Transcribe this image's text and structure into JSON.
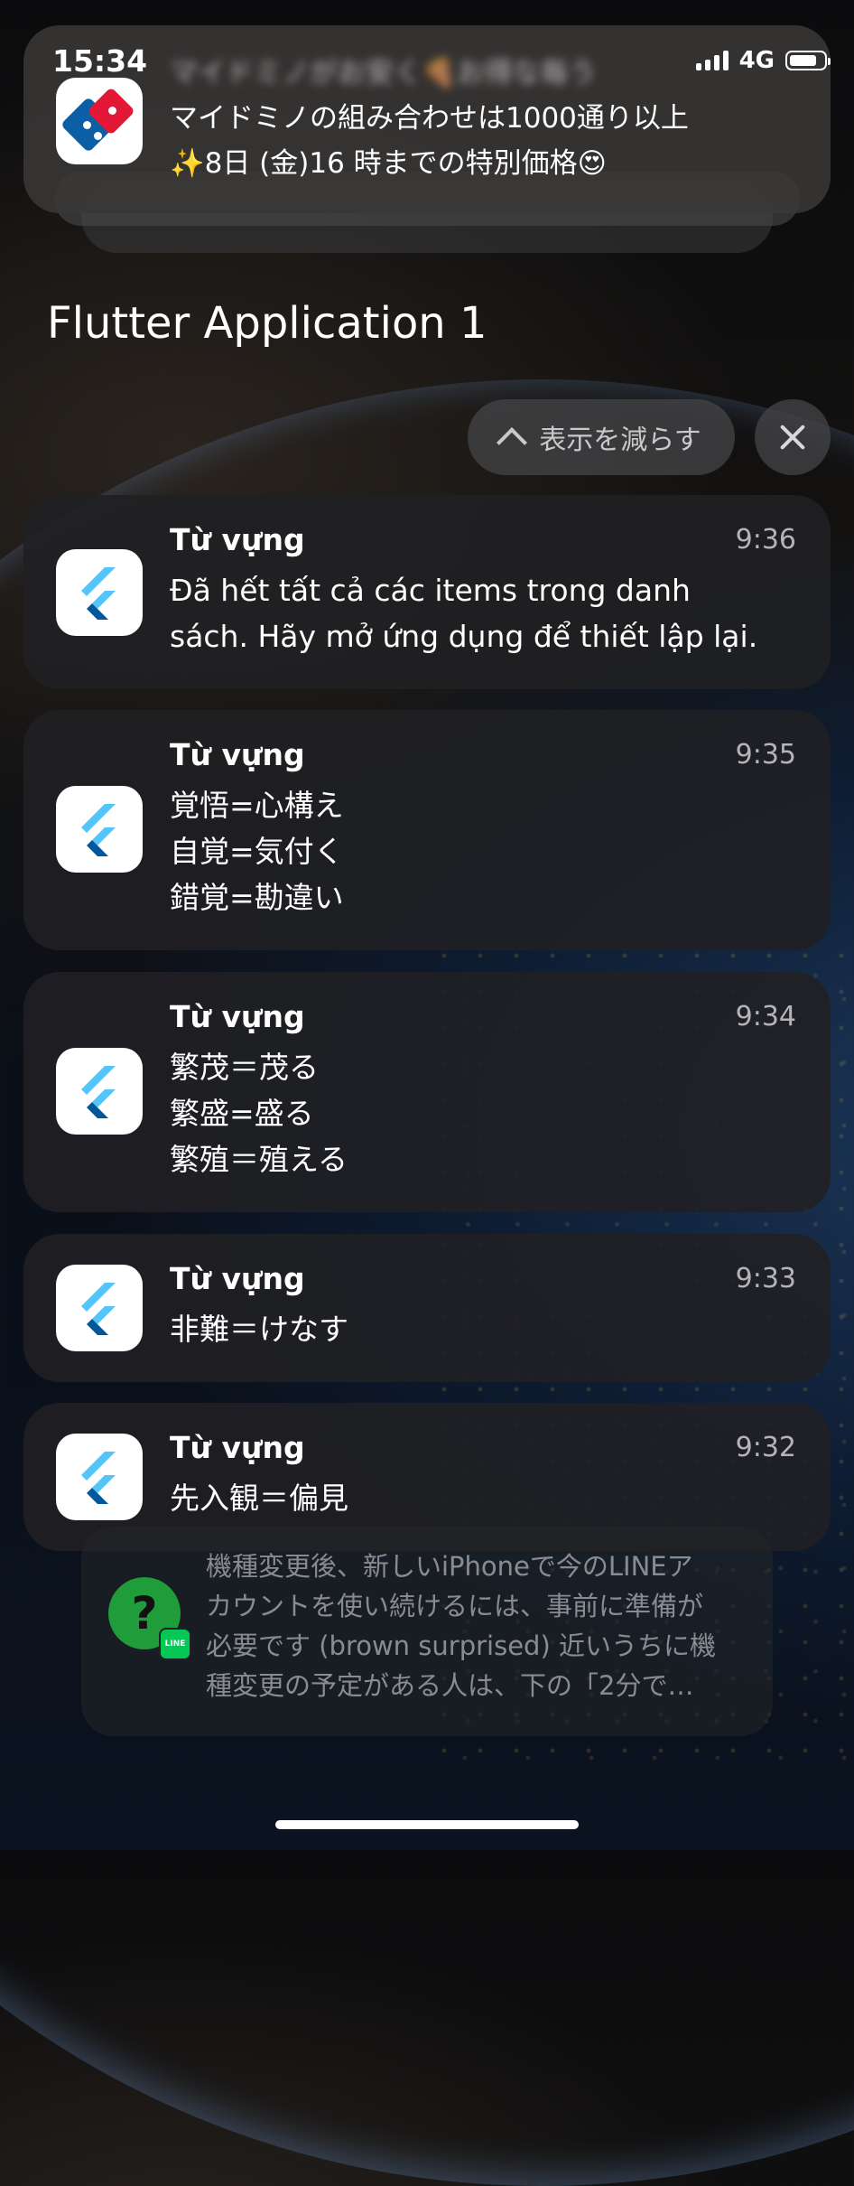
{
  "status_bar": {
    "time": "15:34",
    "network": "4G"
  },
  "top_notification": {
    "app_icon": "dominos-pizza-icon",
    "line1": "マイドミノがお安く🍕お得な毎う",
    "line2": "マイドミノの組み合わせは1000通り以上",
    "line3": "✨8日 (金)16 時までの特別価格😍"
  },
  "group": {
    "title": "Flutter Application 1",
    "show_less_label": "表示を減らす",
    "close_icon": "close-icon"
  },
  "notifications": [
    {
      "title": "Từ vựng",
      "time": "9:36",
      "lines": [
        "Đã hết tất cả các items trong danh",
        "sách. Hãy mở ứng dụng để thiết lập lại."
      ]
    },
    {
      "title": "Từ vựng",
      "time": "9:35",
      "lines": [
        "覚悟=心構え",
        "自覚=気付く",
        "錯覚=勘違い"
      ]
    },
    {
      "title": "Từ vựng",
      "time": "9:34",
      "lines": [
        "繁茂＝茂る",
        "繁盛=盛る",
        "繁殖＝殖える"
      ]
    },
    {
      "title": "Từ vựng",
      "time": "9:33",
      "lines": [
        "非難＝けなす"
      ]
    },
    {
      "title": "Từ vựng",
      "time": "9:32",
      "lines": [
        "先入観＝偏見"
      ]
    }
  ],
  "line_notification": {
    "icon_glyph": "?",
    "badge": "LINE",
    "lines": [
      "機種変更後、新しいiPhoneで今のLINEア",
      "カウントを使い続けるには、事前に準備が",
      "必要です (brown surprised) 近いうちに機",
      "種変更の予定がある人は、下の「2分で…"
    ]
  },
  "colors": {
    "card_bg": "#202024",
    "flutter_light": "#54c5f8",
    "flutter_dark": "#01579b",
    "line_green": "#06c755"
  }
}
